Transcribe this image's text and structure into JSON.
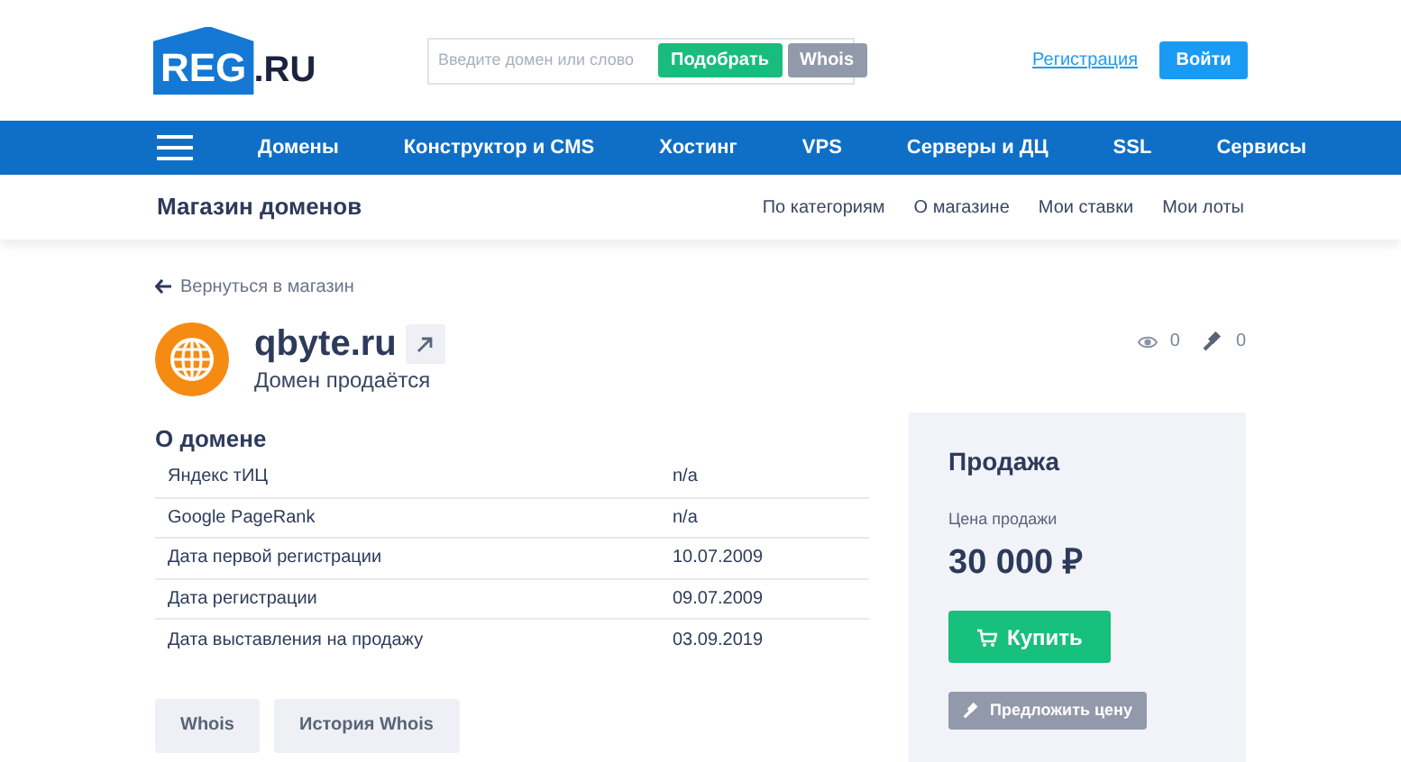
{
  "header": {
    "logo": {
      "mark": "REG",
      "suffix": ".RU"
    },
    "search": {
      "placeholder": "Введите домен или слово"
    },
    "pick_button": "Подобрать",
    "whois_button": "Whois",
    "register_link": "Регистрация",
    "login_button": "Войти"
  },
  "nav": {
    "items": [
      "Домены",
      "Конструктор и CMS",
      "Хостинг",
      "VPS",
      "Серверы и ДЦ",
      "SSL",
      "Сервисы"
    ]
  },
  "subnav": {
    "title": "Магазин доменов",
    "links": [
      "По категориям",
      "О магазине",
      "Мои ставки",
      "Мои лоты"
    ]
  },
  "back_link": "Вернуться в магазин",
  "domain": {
    "name": "qbyte.ru",
    "status": "Домен продаётся",
    "views": "0",
    "bids": "0"
  },
  "about": {
    "title": "О домене",
    "rows": [
      {
        "label": "Яндекс тИЦ",
        "value": "n/a"
      },
      {
        "label": "Google PageRank",
        "value": "n/a"
      },
      {
        "label": "Дата первой регистрации",
        "value": "10.07.2009"
      },
      {
        "label": "Дата регистрации",
        "value": "09.07.2009"
      },
      {
        "label": "Дата выставления на продажу",
        "value": "03.09.2019"
      }
    ],
    "buttons": [
      "Whois",
      "История Whois"
    ]
  },
  "sale": {
    "title": "Продажа",
    "price_label": "Цена продажи",
    "price": "30 000 ₽",
    "buy_button": "Купить",
    "offer_button": "Предложить цену"
  }
}
